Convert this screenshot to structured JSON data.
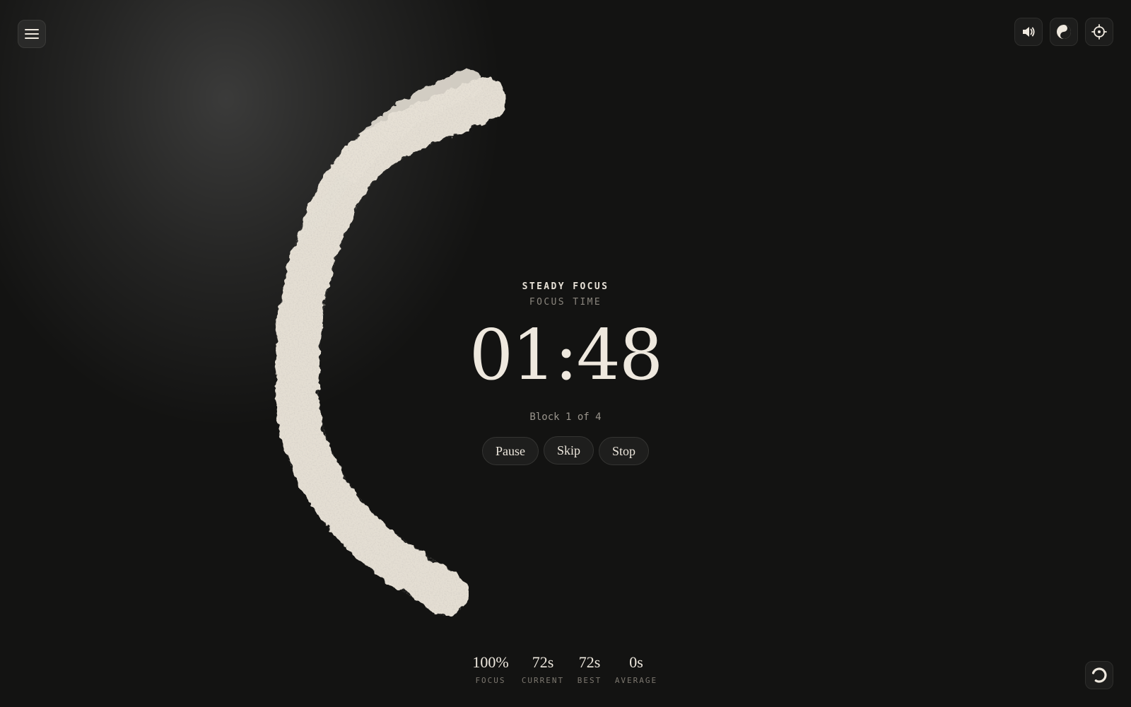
{
  "toolbar": {
    "menu_icon": "hamburger-icon",
    "sound_icon": "speaker-icon",
    "theme_icon": "yin-yang-icon",
    "focus_icon": "crosshair-icon",
    "status_icon": "spinner-icon"
  },
  "session": {
    "mode_title": "STEADY FOCUS",
    "mode_subtitle": "FOCUS TIME",
    "timer": "01:48",
    "block_info": "Block 1 of 4"
  },
  "controls": {
    "pause_label": "Pause",
    "skip_label": "Skip",
    "stop_label": "Stop"
  },
  "stats": [
    {
      "value": "100%",
      "label": "FOCUS"
    },
    {
      "value": "72s",
      "label": "CURRENT"
    },
    {
      "value": "72s",
      "label": "BEST"
    },
    {
      "value": "0s",
      "label": "AVERAGE"
    }
  ],
  "colors": {
    "background": "#131312",
    "ink": "#efe9df",
    "muted": "#8a857d"
  }
}
